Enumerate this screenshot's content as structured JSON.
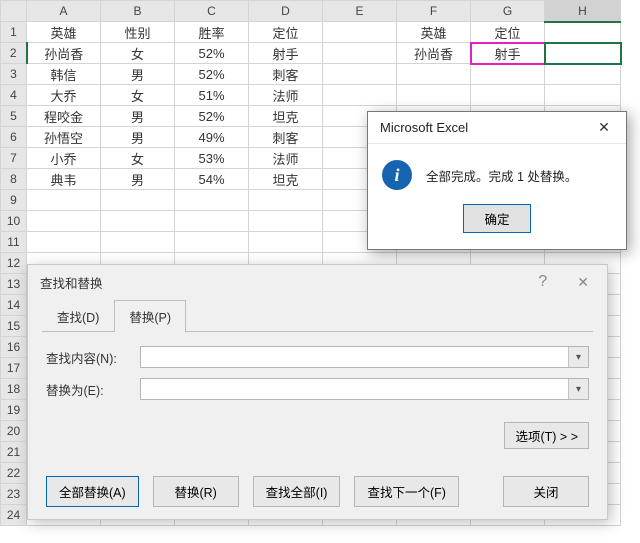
{
  "grid": {
    "cols": [
      "A",
      "B",
      "C",
      "D",
      "E",
      "F",
      "G",
      "H"
    ],
    "rows": 24,
    "data": [
      [
        "英雄",
        "性别",
        "胜率",
        "定位",
        "",
        "英雄",
        "定位",
        ""
      ],
      [
        "孙尚香",
        "女",
        "52%",
        "射手",
        "",
        "孙尚香",
        "射手",
        ""
      ],
      [
        "韩信",
        "男",
        "52%",
        "刺客",
        "",
        "",
        "",
        ""
      ],
      [
        "大乔",
        "女",
        "51%",
        "法师",
        "",
        "",
        "",
        ""
      ],
      [
        "程咬金",
        "男",
        "52%",
        "坦克",
        "",
        "",
        "",
        ""
      ],
      [
        "孙悟空",
        "男",
        "49%",
        "刺客",
        "",
        "",
        "",
        ""
      ],
      [
        "小乔",
        "女",
        "53%",
        "法师",
        "",
        "",
        "",
        ""
      ],
      [
        "典韦",
        "男",
        "54%",
        "坦克",
        "",
        "",
        "",
        ""
      ]
    ],
    "highlight": {
      "r": 2,
      "c": "G"
    },
    "selected": {
      "r": 2,
      "c": "H"
    }
  },
  "msgbox": {
    "title": "Microsoft Excel",
    "text": "全部完成。完成 1 处替换。",
    "ok": "确定",
    "info_glyph": "i"
  },
  "fr": {
    "title": "查找和替换",
    "tab_find": "查找(D)",
    "tab_replace": "替换(P)",
    "find_label": "查找内容(N):",
    "replace_label": "替换为(E):",
    "find_value": "",
    "replace_value": "",
    "options": "选项(T) > >",
    "btn_replace_all": "全部替换(A)",
    "btn_replace": "替换(R)",
    "btn_find_all": "查找全部(I)",
    "btn_find_next": "查找下一个(F)",
    "btn_close": "关闭"
  }
}
